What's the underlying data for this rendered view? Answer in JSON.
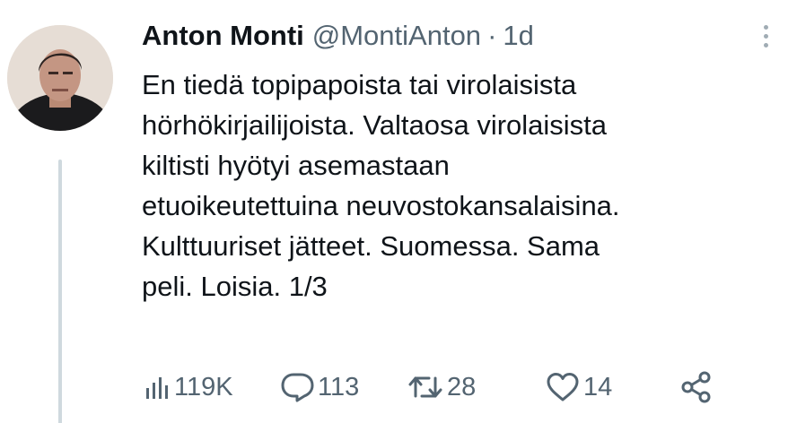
{
  "author": {
    "name": "Anton Monti",
    "handle": "@MontiAnton",
    "separator": "·",
    "time": "1d"
  },
  "body_lines": [
    "En tiedä topipapoista tai virolaisista",
    "hörhökirjailijoista. Valtaosa virolaisista",
    "kiltisti hyötyi asemastaan",
    "etuoikeutettuina neuvostokansalaisina.",
    "Kulttuuriset jätteet. Suomessa. Sama",
    "peli. Loisia. 1/3"
  ],
  "actions": {
    "views": "119K",
    "replies": "113",
    "retweets": "28",
    "likes": "14"
  },
  "icons": {
    "views": "analytics-icon",
    "replies": "reply-icon",
    "retweets": "retweet-icon",
    "likes": "heart-icon",
    "share": "share-icon",
    "more": "more-vertical-icon"
  },
  "colors": {
    "text": "#0f1419",
    "secondary": "#536471",
    "thread_line": "#cfd9de"
  }
}
